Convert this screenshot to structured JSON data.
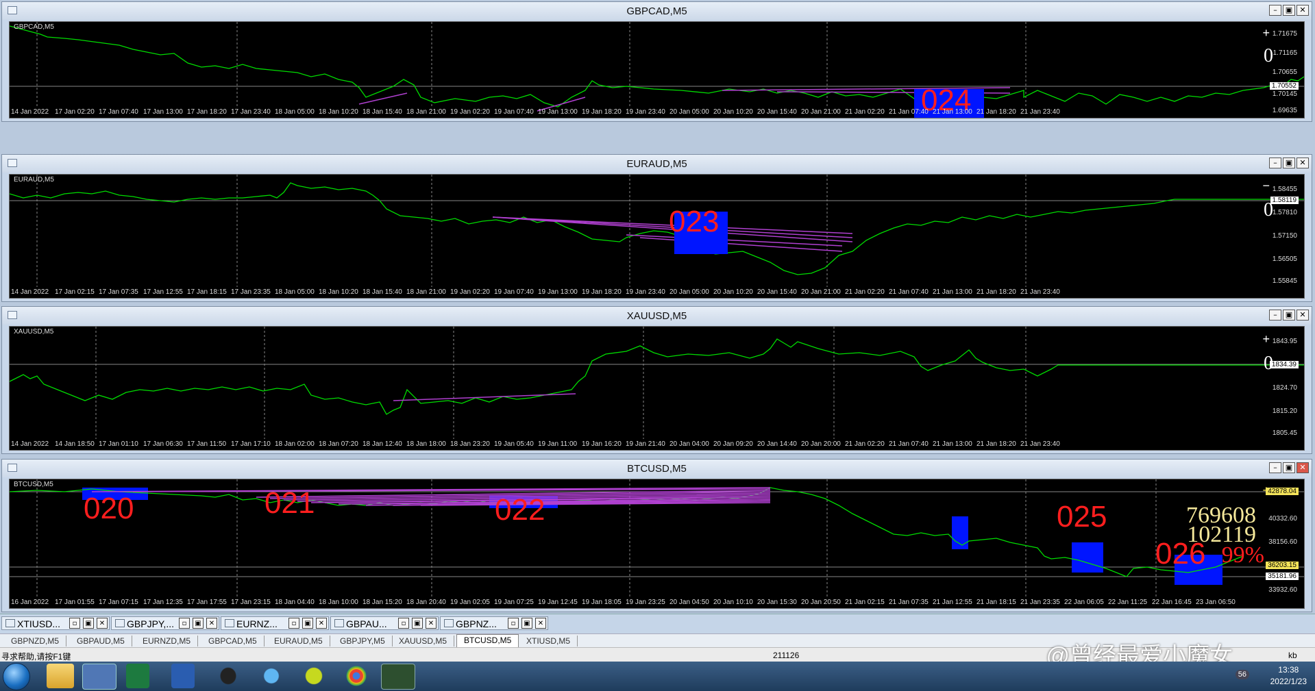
{
  "windows": [
    {
      "id": "gbpcad",
      "title": "GBPCAD,M5",
      "tag": "GBPCAD,M5",
      "xlabels": [
        "14 Jan 2022",
        "17 Jan 02:20",
        "17 Jan 07:40",
        "17 Jan 13:00",
        "17 Jan 18:20",
        "17 Jan 23:40",
        "18 Jan 05:00",
        "18 Jan 10:20",
        "18 Jan 15:40",
        "18 Jan 21:00",
        "19 Jan 02:20",
        "19 Jan 07:40",
        "19 Jan 13:00",
        "19 Jan 18:20",
        "19 Jan 23:40",
        "20 Jan 05:00",
        "20 Jan 10:20",
        "20 Jan 15:40",
        "20 Jan 21:00",
        "21 Jan 02:20",
        "21 Jan 07:40",
        "21 Jan 13:00",
        "21 Jan 18:20",
        "21 Jan 23:40"
      ],
      "ylabels": [
        "1.71675",
        "1.71165",
        "1.70655",
        "1.70145",
        "1.69635"
      ],
      "price": "1.70552",
      "sign": "+",
      "zero": "0",
      "label": "024"
    },
    {
      "id": "euraud",
      "title": "EURAUD,M5",
      "tag": "EURAUD,M5",
      "xlabels": [
        "14 Jan 2022",
        "17 Jan 02:15",
        "17 Jan 07:35",
        "17 Jan 12:55",
        "17 Jan 18:15",
        "17 Jan 23:35",
        "18 Jan 05:00",
        "18 Jan 10:20",
        "18 Jan 15:40",
        "18 Jan 21:00",
        "19 Jan 02:20",
        "19 Jan 07:40",
        "19 Jan 13:00",
        "19 Jan 18:20",
        "19 Jan 23:40",
        "20 Jan 05:00",
        "20 Jan 10:20",
        "20 Jan 15:40",
        "20 Jan 21:00",
        "21 Jan 02:20",
        "21 Jan 07:40",
        "21 Jan 13:00",
        "21 Jan 18:20",
        "21 Jan 23:40"
      ],
      "ylabels": [
        "1.58455",
        "1.57810",
        "1.57150",
        "1.56505",
        "1.55845"
      ],
      "price": "1.58119",
      "sign": "−",
      "zero": "0",
      "label": "023"
    },
    {
      "id": "xauusd",
      "title": "XAUUSD,M5",
      "tag": "XAUUSD,M5",
      "xlabels": [
        "14 Jan 2022",
        "14 Jan 18:50",
        "17 Jan 01:10",
        "17 Jan 06:30",
        "17 Jan 11:50",
        "17 Jan 17:10",
        "18 Jan 02:00",
        "18 Jan 07:20",
        "18 Jan 12:40",
        "18 Jan 18:00",
        "18 Jan 23:20",
        "19 Jan 05:40",
        "19 Jan 11:00",
        "19 Jan 16:20",
        "19 Jan 21:40",
        "20 Jan 04:00",
        "20 Jan 09:20",
        "20 Jan 14:40",
        "20 Jan 20:00",
        "21 Jan 02:20",
        "21 Jan 07:40",
        "21 Jan 13:00",
        "21 Jan 18:20",
        "21 Jan 23:40"
      ],
      "ylabels": [
        "1843.95",
        "1834.39",
        "1824.70",
        "1815.20",
        "1805.45"
      ],
      "price": "1834.39",
      "sign": "+",
      "zero": "0"
    },
    {
      "id": "btcusd",
      "title": "BTCUSD,M5",
      "tag": "BTCUSD,M5",
      "xlabels": [
        "16 Jan 2022",
        "17 Jan 01:55",
        "17 Jan 07:15",
        "17 Jan 12:35",
        "17 Jan 17:55",
        "17 Jan 23:15",
        "18 Jan 04:40",
        "18 Jan 10:00",
        "18 Jan 15:20",
        "18 Jan 20:40",
        "19 Jan 02:05",
        "19 Jan 07:25",
        "19 Jan 12:45",
        "19 Jan 18:05",
        "19 Jan 23:25",
        "20 Jan 04:50",
        "20 Jan 10:10",
        "20 Jan 15:30",
        "20 Jan 20:50",
        "21 Jan 02:15",
        "21 Jan 07:35",
        "21 Jan 12:55",
        "21 Jan 18:15",
        "21 Jan 23:35",
        "22 Jan 06:05",
        "22 Jan 11:25",
        "22 Jan 16:45",
        "23 Jan 06:50"
      ],
      "ylabels": [
        "42878.04",
        "40332.60",
        "38156.60",
        "36203.15",
        "35181.96",
        "33932.60"
      ],
      "price": "42878.04",
      "price2": "36203.15",
      "price3": "35181.96",
      "sign": "+",
      "labels": [
        "020",
        "021",
        "022",
        "025",
        "026"
      ],
      "big1": "769608",
      "big2": "102119",
      "pct": "99%"
    }
  ],
  "window_tabs": [
    "XTIUSD...",
    "GBPJPY,...",
    "EURNZ...",
    "GBPAU...",
    "GBPNZ..."
  ],
  "symbol_tabs": [
    "GBPNZD,M5",
    "GBPAUD,M5",
    "EURNZD,M5",
    "GBPCAD,M5",
    "EURAUD,M5",
    "GBPJPY,M5",
    "XAUUSD,M5",
    "BTCUSD,M5",
    "XTIUSD,M5"
  ],
  "active_symbol_tab": "BTCUSD,M5",
  "status": {
    "help": "寻求帮助,请按F1键",
    "value": "211126",
    "kb": "kb"
  },
  "tray": {
    "time": "13:38",
    "date": "2022/1/23",
    "badge": "56"
  },
  "watermark": "@曾经最爱小魔女",
  "colors": {
    "line": "#00dd00",
    "trend": "#b040d0",
    "box": "#0015ff",
    "label": "#ff1e1e",
    "bg": "#000000"
  }
}
